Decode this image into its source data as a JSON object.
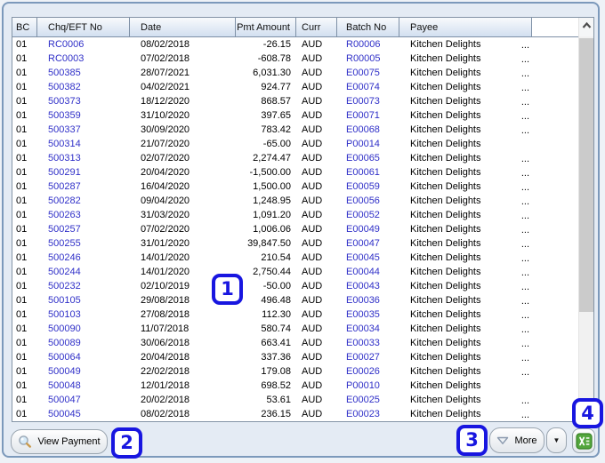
{
  "table": {
    "columns": [
      "BC",
      "Chq/EFT No",
      "Date",
      "Pmt Amount",
      "Curr",
      "Batch No",
      "Payee",
      ""
    ],
    "rows": [
      [
        "01",
        "RC0006",
        "08/02/2018",
        "-26.15",
        "AUD",
        "R00006",
        "Kitchen Delights",
        "..."
      ],
      [
        "01",
        "RC0003",
        "07/02/2018",
        "-608.78",
        "AUD",
        "R00005",
        "Kitchen Delights",
        "..."
      ],
      [
        "01",
        "500385",
        "28/07/2021",
        "6,031.30",
        "AUD",
        "E00075",
        "Kitchen Delights",
        "..."
      ],
      [
        "01",
        "500382",
        "04/02/2021",
        "924.77",
        "AUD",
        "E00074",
        "Kitchen Delights",
        "..."
      ],
      [
        "01",
        "500373",
        "18/12/2020",
        "868.57",
        "AUD",
        "E00073",
        "Kitchen Delights",
        "..."
      ],
      [
        "01",
        "500359",
        "31/10/2020",
        "397.65",
        "AUD",
        "E00071",
        "Kitchen Delights",
        "..."
      ],
      [
        "01",
        "500337",
        "30/09/2020",
        "783.42",
        "AUD",
        "E00068",
        "Kitchen Delights",
        "..."
      ],
      [
        "01",
        "500314",
        "21/07/2020",
        "-65.00",
        "AUD",
        "P00014",
        "Kitchen Delights",
        ""
      ],
      [
        "01",
        "500313",
        "02/07/2020",
        "2,274.47",
        "AUD",
        "E00065",
        "Kitchen Delights",
        "..."
      ],
      [
        "01",
        "500291",
        "20/04/2020",
        "-1,500.00",
        "AUD",
        "E00061",
        "Kitchen Delights",
        "..."
      ],
      [
        "01",
        "500287",
        "16/04/2020",
        "1,500.00",
        "AUD",
        "E00059",
        "Kitchen Delights",
        "..."
      ],
      [
        "01",
        "500282",
        "09/04/2020",
        "1,248.95",
        "AUD",
        "E00056",
        "Kitchen Delights",
        "..."
      ],
      [
        "01",
        "500263",
        "31/03/2020",
        "1,091.20",
        "AUD",
        "E00052",
        "Kitchen Delights",
        "..."
      ],
      [
        "01",
        "500257",
        "07/02/2020",
        "1,006.06",
        "AUD",
        "E00049",
        "Kitchen Delights",
        "..."
      ],
      [
        "01",
        "500255",
        "31/01/2020",
        "39,847.50",
        "AUD",
        "E00047",
        "Kitchen Delights",
        "..."
      ],
      [
        "01",
        "500246",
        "14/01/2020",
        "210.54",
        "AUD",
        "E00045",
        "Kitchen Delights",
        "..."
      ],
      [
        "01",
        "500244",
        "14/01/2020",
        "2,750.44",
        "AUD",
        "E00044",
        "Kitchen Delights",
        "..."
      ],
      [
        "01",
        "500232",
        "02/10/2019",
        "-50.00",
        "AUD",
        "E00043",
        "Kitchen Delights",
        "..."
      ],
      [
        "01",
        "500105",
        "29/08/2018",
        "496.48",
        "AUD",
        "E00036",
        "Kitchen Delights",
        "..."
      ],
      [
        "01",
        "500103",
        "27/08/2018",
        "112.30",
        "AUD",
        "E00035",
        "Kitchen Delights",
        "..."
      ],
      [
        "01",
        "500090",
        "11/07/2018",
        "580.74",
        "AUD",
        "E00034",
        "Kitchen Delights",
        "..."
      ],
      [
        "01",
        "500089",
        "30/06/2018",
        "663.41",
        "AUD",
        "E00033",
        "Kitchen Delights",
        "..."
      ],
      [
        "01",
        "500064",
        "20/04/2018",
        "337.36",
        "AUD",
        "E00027",
        "Kitchen Delights",
        "..."
      ],
      [
        "01",
        "500049",
        "22/02/2018",
        "179.08",
        "AUD",
        "E00026",
        "Kitchen Delights",
        "..."
      ],
      [
        "01",
        "500048",
        "12/01/2018",
        "698.52",
        "AUD",
        "P00010",
        "Kitchen Delights",
        ""
      ],
      [
        "01",
        "500047",
        "20/02/2018",
        "53.61",
        "AUD",
        "E00025",
        "Kitchen Delights",
        "..."
      ],
      [
        "01",
        "500045",
        "08/02/2018",
        "236.15",
        "AUD",
        "E00023",
        "Kitchen Delights",
        "..."
      ]
    ]
  },
  "toolbar": {
    "view_payment_label": "View Payment",
    "more_label": "More"
  },
  "callouts": [
    "1",
    "2",
    "3",
    "4"
  ],
  "icons": {
    "magnifier": "magnifier-icon",
    "triangle_down": "triangle-down-icon",
    "caret_down": "caret-down-icon",
    "caret_char": "▼",
    "excel": "excel-export-icon",
    "scroll_up": "chevron-up-icon"
  },
  "colors": {
    "callout_blue": "#1816e0",
    "link_blue": "#3030c8",
    "excel_green": "#53a63d",
    "panel_border": "#7c99bb",
    "header_gradient_top": "#f8fafc",
    "header_gradient_bottom": "#d2dff0"
  }
}
